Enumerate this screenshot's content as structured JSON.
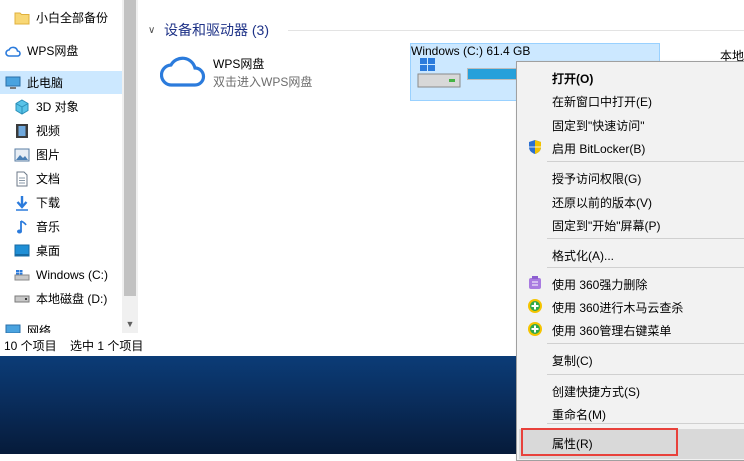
{
  "sidebar": {
    "items": [
      {
        "label": "小白全部备份",
        "icon": "folder-icon"
      },
      {
        "label": "WPS网盘",
        "icon": "cloud-icon"
      },
      {
        "label": "此电脑",
        "icon": "computer-icon"
      },
      {
        "label": "3D 对象",
        "icon": "3d-objects-icon"
      },
      {
        "label": "视频",
        "icon": "video-icon"
      },
      {
        "label": "图片",
        "icon": "pictures-icon"
      },
      {
        "label": "文档",
        "icon": "documents-icon"
      },
      {
        "label": "下载",
        "icon": "download-icon"
      },
      {
        "label": "音乐",
        "icon": "music-icon"
      },
      {
        "label": "桌面",
        "icon": "desktop-icon"
      },
      {
        "label": "Windows (C:)",
        "icon": "windows-drive-icon"
      },
      {
        "label": "本地磁盘 (D:)",
        "icon": "local-disk-icon"
      },
      {
        "label": "网络",
        "icon": "network-icon"
      }
    ]
  },
  "status": {
    "item_count": "10 个项目",
    "selected": "选中 1 个项目"
  },
  "content": {
    "group_title": "设备和驱动器 (3)",
    "wps": {
      "name": "WPS网盘",
      "sub": "双击进入WPS网盘"
    },
    "drive_c": {
      "name": "Windows (C:)",
      "free": "61.4 GB",
      "used_fraction": 0.95
    },
    "drive_d": {
      "name": "本地"
    }
  },
  "context_menu": {
    "items": [
      {
        "label": "打开(O)",
        "bold": true
      },
      {
        "label": "在新窗口中打开(E)"
      },
      {
        "label": "固定到\"快速访问\""
      },
      {
        "label": "启用 BitLocker(B)",
        "icon": "uac-shield-icon"
      },
      {
        "label": "授予访问权限(G)",
        "submenu": true
      },
      {
        "label": "还原以前的版本(V)"
      },
      {
        "label": "固定到\"开始\"屏幕(P)"
      },
      {
        "label": "格式化(A)..."
      },
      {
        "label": "使用 360强力删除",
        "icon": "360-delete-icon"
      },
      {
        "label": "使用 360进行木马云查杀",
        "icon": "360-scan-icon"
      },
      {
        "label": "使用 360管理右键菜单",
        "icon": "360-manage-icon"
      },
      {
        "label": "复制(C)"
      },
      {
        "label": "创建快捷方式(S)"
      },
      {
        "label": "重命名(M)"
      },
      {
        "label": "属性(R)",
        "highlighted": true
      }
    ]
  },
  "colors": {
    "accent": "#26a0da",
    "selection": "#cce8ff",
    "highlight_box": "#e8413b"
  }
}
